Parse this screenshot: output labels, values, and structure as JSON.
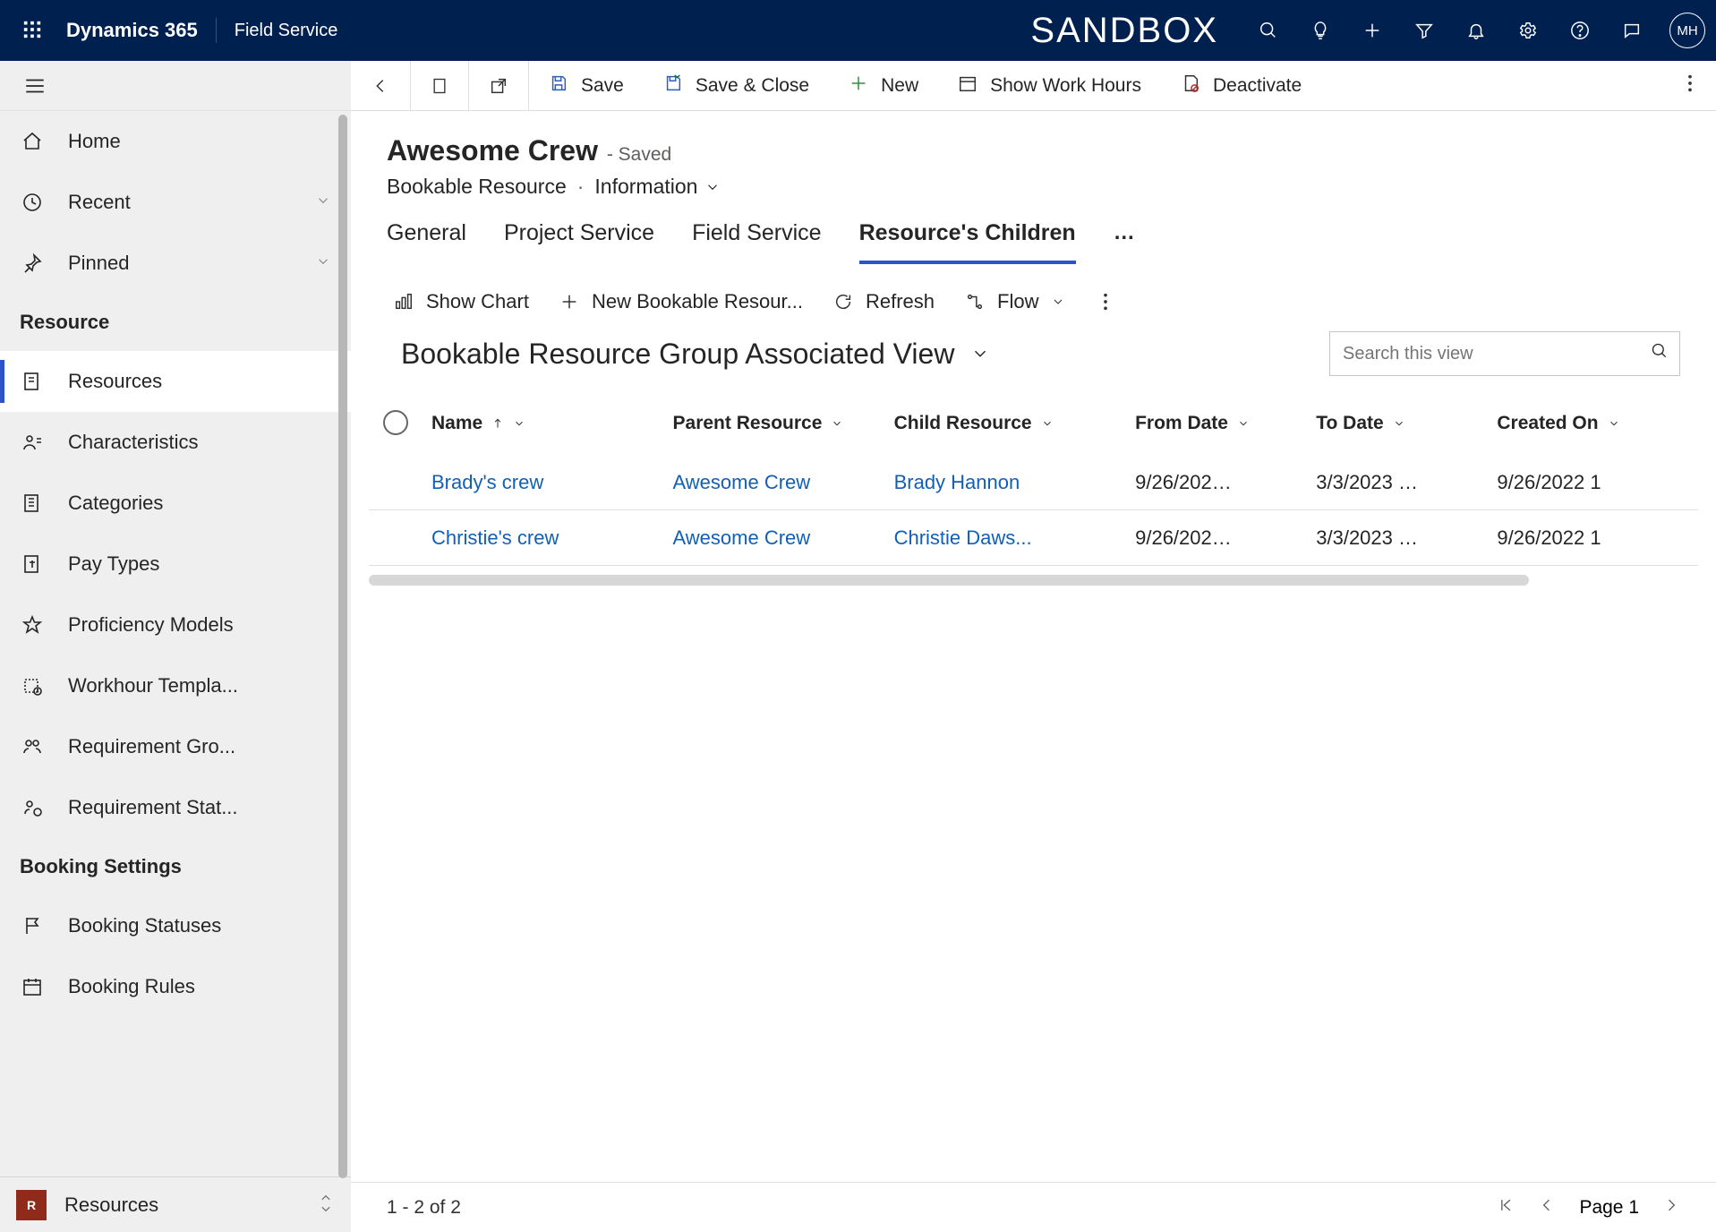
{
  "topbar": {
    "brand": "Dynamics 365",
    "app": "Field Service",
    "environment": "SANDBOX",
    "avatar_initials": "MH"
  },
  "sidebar": {
    "items": [
      {
        "label": "Home",
        "icon": "home-icon"
      },
      {
        "label": "Recent",
        "icon": "clock-icon",
        "chevron": true
      },
      {
        "label": "Pinned",
        "icon": "pin-icon",
        "chevron": true
      }
    ],
    "resource_heading": "Resource",
    "resource_items": [
      {
        "label": "Resources",
        "icon": "resource-icon",
        "active": true
      },
      {
        "label": "Characteristics",
        "icon": "person-icon"
      },
      {
        "label": "Categories",
        "icon": "category-icon"
      },
      {
        "label": "Pay Types",
        "icon": "paytype-icon"
      },
      {
        "label": "Proficiency Models",
        "icon": "star-icon"
      },
      {
        "label": "Workhour Templa...",
        "icon": "workhour-icon"
      },
      {
        "label": "Requirement Gro...",
        "icon": "reqgroup-icon"
      },
      {
        "label": "Requirement Stat...",
        "icon": "reqstatus-icon"
      }
    ],
    "booking_heading": "Booking Settings",
    "booking_items": [
      {
        "label": "Booking Statuses",
        "icon": "flag-icon"
      },
      {
        "label": "Booking Rules",
        "icon": "calendar-icon"
      }
    ],
    "area_switch": {
      "initial": "R",
      "label": "Resources"
    }
  },
  "commandbar": {
    "save": "Save",
    "save_close": "Save & Close",
    "new": "New",
    "show_work_hours": "Show Work Hours",
    "deactivate": "Deactivate"
  },
  "record": {
    "title": "Awesome Crew",
    "state": "- Saved",
    "entity": "Bookable Resource",
    "form_name": "Information"
  },
  "tabs": {
    "items": [
      {
        "label": "General"
      },
      {
        "label": "Project Service"
      },
      {
        "label": "Field Service"
      },
      {
        "label": "Resource's Children",
        "active": true
      }
    ],
    "overflow": "…"
  },
  "subcmd": {
    "show_chart": "Show Chart",
    "new_record": "New Bookable Resour...",
    "refresh": "Refresh",
    "flow": "Flow"
  },
  "view": {
    "name": "Bookable Resource Group Associated View",
    "search_placeholder": "Search this view"
  },
  "grid": {
    "columns": [
      "Name",
      "Parent Resource",
      "Child Resource",
      "From Date",
      "To Date",
      "Created On"
    ],
    "rows": [
      {
        "name": "Brady's crew",
        "parent": "Awesome Crew",
        "child": "Brady Hannon",
        "from": "9/26/202…",
        "to": "3/3/2023 …",
        "created": "9/26/2022 1"
      },
      {
        "name": "Christie's crew",
        "parent": "Awesome Crew",
        "child": "Christie Daws...",
        "from": "9/26/202…",
        "to": "3/3/2023 …",
        "created": "9/26/2022 1"
      }
    ]
  },
  "footer": {
    "range": "1 - 2 of 2",
    "page_label": "Page 1"
  }
}
